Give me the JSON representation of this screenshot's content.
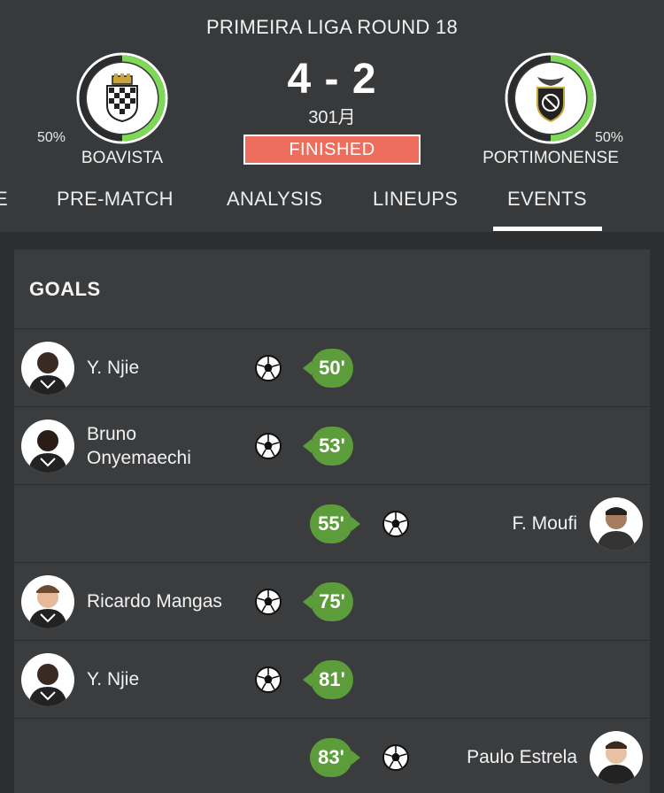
{
  "match": {
    "round_title": "PRIMEIRA LIGA ROUND 18",
    "score": "4 - 2",
    "date": "301月",
    "status": "FINISHED",
    "home": {
      "name": "BOAVISTA",
      "pct_label": "50%",
      "ring_fraction": 0.5,
      "ring_color": "#7ed957"
    },
    "away": {
      "name": "PORTIMONENSE",
      "pct_label": "50%",
      "ring_fraction": 0.5,
      "ring_color": "#7ed957"
    }
  },
  "tabs": [
    {
      "label": "E"
    },
    {
      "label": "PRE-MATCH"
    },
    {
      "label": "ANALYSIS"
    },
    {
      "label": "LINEUPS"
    },
    {
      "label": "EVENTS",
      "active": true
    }
  ],
  "goals": {
    "title": "GOALS",
    "events": [
      {
        "side": "home",
        "player": "Y. Njie",
        "minute": "50'"
      },
      {
        "side": "home",
        "player": "Bruno Onyemaechi",
        "player_lines": [
          "Bruno",
          "Onyemaechi"
        ],
        "minute": "53'"
      },
      {
        "side": "away",
        "player": "F. Moufi",
        "minute": "55'"
      },
      {
        "side": "home",
        "player": "Ricardo Mangas",
        "minute": "75'"
      },
      {
        "side": "home",
        "player": "Y. Njie",
        "minute": "81'"
      },
      {
        "side": "away",
        "player": "Paulo Estrela",
        "minute": "83'"
      }
    ]
  },
  "colors": {
    "minute_badge": "#5c9c3a",
    "status_badge": "#ee6e5d",
    "accent_ring": "#7ed957"
  },
  "icons": {
    "goal": "soccer-ball-icon"
  }
}
